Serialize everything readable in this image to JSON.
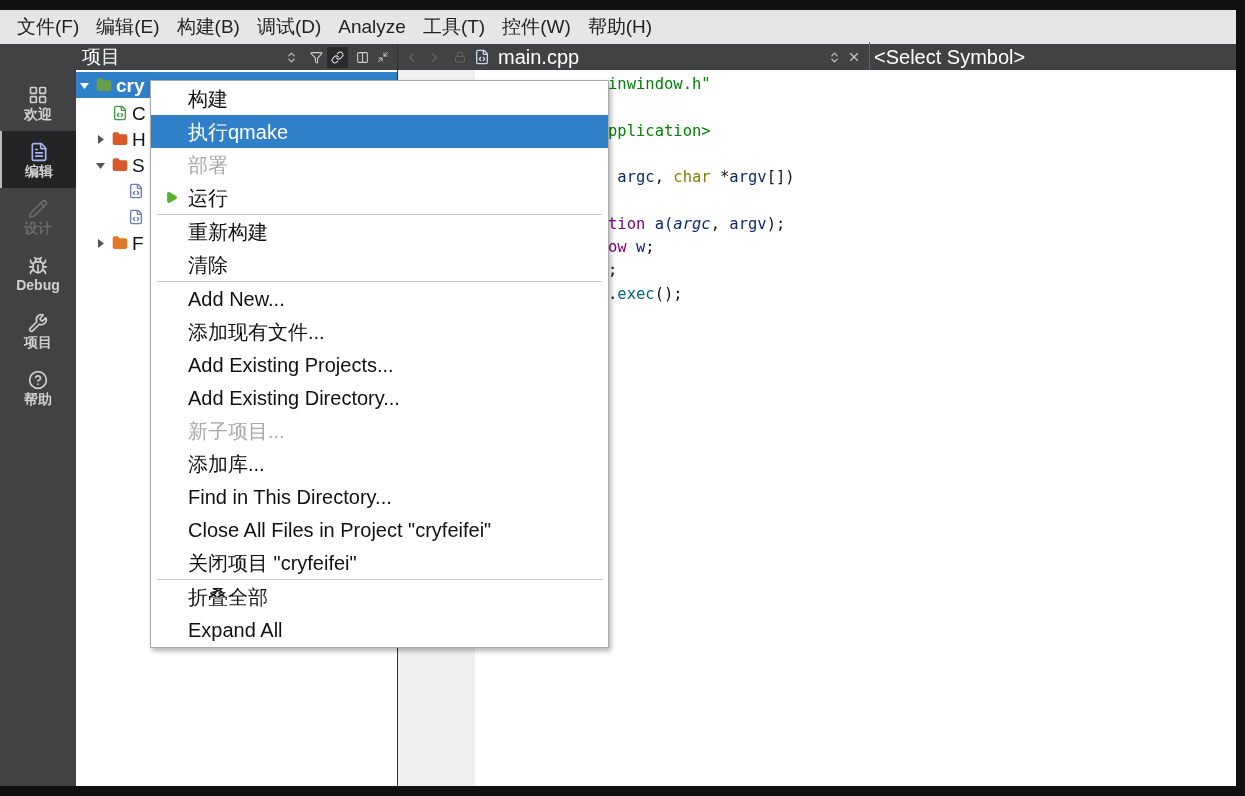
{
  "menubar": [
    {
      "label": "文件(F)"
    },
    {
      "label": "编辑(E)"
    },
    {
      "label": "构建(B)"
    },
    {
      "label": "调试(D)"
    },
    {
      "label": "Analyze"
    },
    {
      "label": "工具(T)"
    },
    {
      "label": "控件(W)"
    },
    {
      "label": "帮助(H)"
    }
  ],
  "modes": [
    {
      "label": "欢迎",
      "selected": false,
      "disabled": false
    },
    {
      "label": "编辑",
      "selected": true,
      "disabled": false
    },
    {
      "label": "设计",
      "selected": false,
      "disabled": true
    },
    {
      "label": "Debug",
      "selected": false,
      "disabled": false
    },
    {
      "label": "项目",
      "selected": false,
      "disabled": false
    },
    {
      "label": "帮助",
      "selected": false,
      "disabled": false
    }
  ],
  "project_panel": {
    "title": "项目",
    "tree": [
      {
        "label": "cry",
        "kind": "project",
        "selected": true,
        "expanded": true,
        "children": [
          {
            "label": "C",
            "kind": "profile",
            "selected": false,
            "expanded": false
          },
          {
            "label": "H",
            "kind": "headers",
            "selected": false,
            "expanded": false
          },
          {
            "label": "S",
            "kind": "sources",
            "selected": false,
            "expanded": true,
            "children": [
              {
                "kind": "cpp",
                "selected": false,
                "expanded": false
              },
              {
                "kind": "cpp",
                "selected": false,
                "expanded": false
              }
            ]
          },
          {
            "label": "F",
            "kind": "forms",
            "selected": false,
            "expanded": false
          }
        ]
      }
    ]
  },
  "editor": {
    "file_name": "main.cpp",
    "symbol": "<Select Symbol>",
    "lines": [
      {
        "gap_before": false,
        "segments": [
          {
            "text": "inwindow.h\"",
            "kind": "string"
          }
        ]
      },
      {
        "gap_before": true,
        "segments": [
          {
            "text": "pplication>",
            "kind": "string"
          }
        ]
      },
      {
        "gap_before": true,
        "segments": [
          {
            "text": " argc",
            "kind": "var"
          },
          {
            "text": ", ",
            "kind": "plain"
          },
          {
            "text": "char",
            "kind": "type"
          },
          {
            "text": " *",
            "kind": "plain"
          },
          {
            "text": "argv",
            "kind": "var"
          },
          {
            "text": "[])",
            "kind": "plain"
          }
        ]
      },
      {
        "gap_before": true,
        "segments": [
          {
            "text": "tion",
            "kind": "class"
          },
          {
            "text": " a(",
            "kind": "var"
          },
          {
            "text": "argc",
            "kind": "param"
          },
          {
            "text": ", ",
            "kind": "plain"
          },
          {
            "text": "argv",
            "kind": "var"
          },
          {
            "text": ");",
            "kind": "plain"
          }
        ]
      },
      {
        "gap_before": false,
        "segments": [
          {
            "text": "ow",
            "kind": "class"
          },
          {
            "text": " w",
            "kind": "var"
          },
          {
            "text": ";",
            "kind": "plain"
          }
        ]
      },
      {
        "gap_before": false,
        "segments": [
          {
            "text": ";",
            "kind": "plain"
          }
        ]
      },
      {
        "gap_before": false,
        "segments": [
          {
            "text": ".",
            "kind": "plain"
          },
          {
            "text": "exec",
            "kind": "func"
          },
          {
            "text": "();",
            "kind": "plain"
          }
        ]
      }
    ]
  },
  "context_menu": [
    {
      "kind": "item",
      "label": "构建",
      "selected": false,
      "disabled": false
    },
    {
      "kind": "item",
      "label": "执行qmake",
      "selected": true,
      "disabled": false
    },
    {
      "kind": "item",
      "label": "部署",
      "selected": false,
      "disabled": true
    },
    {
      "kind": "run",
      "label": "运行",
      "selected": false,
      "disabled": false
    },
    {
      "kind": "separator"
    },
    {
      "kind": "item",
      "label": "重新构建",
      "selected": false,
      "disabled": false
    },
    {
      "kind": "item",
      "label": "清除",
      "selected": false,
      "disabled": false
    },
    {
      "kind": "separator"
    },
    {
      "kind": "item",
      "label": "Add New...",
      "selected": false,
      "disabled": false
    },
    {
      "kind": "item",
      "label": "添加现有文件...",
      "selected": false,
      "disabled": false
    },
    {
      "kind": "item",
      "label": "Add Existing Projects...",
      "selected": false,
      "disabled": false
    },
    {
      "kind": "item",
      "label": "Add Existing Directory...",
      "selected": false,
      "disabled": false
    },
    {
      "kind": "item",
      "label": "新子项目...",
      "selected": false,
      "disabled": true
    },
    {
      "kind": "item",
      "label": "添加库...",
      "selected": false,
      "disabled": false
    },
    {
      "kind": "item",
      "label": "Find in This Directory...",
      "selected": false,
      "disabled": false
    },
    {
      "kind": "item",
      "label": "Close All Files in Project \"cryfeifei\"",
      "selected": false,
      "disabled": false
    },
    {
      "kind": "item",
      "label": "关闭项目 \"cryfeifei\"",
      "selected": false,
      "disabled": false
    },
    {
      "kind": "separator"
    },
    {
      "kind": "item",
      "label": "折叠全部",
      "selected": false,
      "disabled": false
    },
    {
      "kind": "item",
      "label": "Expand All",
      "selected": false,
      "disabled": false
    }
  ]
}
